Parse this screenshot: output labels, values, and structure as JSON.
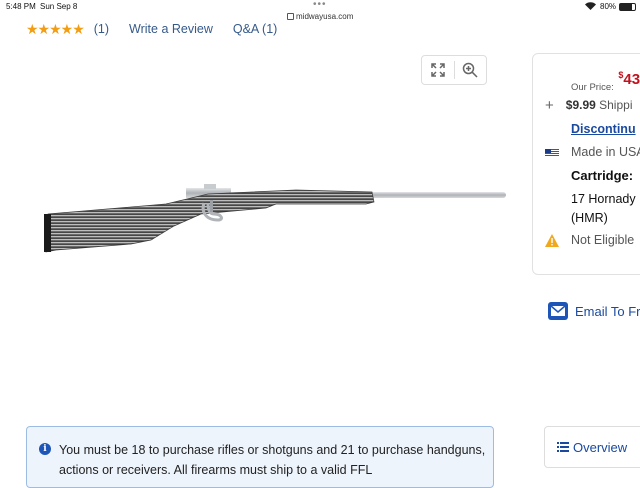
{
  "status_bar": {
    "time": "5:48 PM",
    "date": "Sun Sep 8",
    "url": "midwayusa.com",
    "battery": "80%",
    "battery_level": 0.8
  },
  "topnav": {
    "stars": "★★★★★",
    "rating_count": "(1)",
    "write_review": "Write a Review",
    "qa": "Q&A (1)"
  },
  "gallery": {
    "expand_icon": "expand-icon",
    "zoom_icon": "zoom-in-icon",
    "image_subject": "rifle-image"
  },
  "purchase_panel": {
    "our_price_label": "Our Price:",
    "price_symbol": "$",
    "price_value": "43",
    "shipping_price": "$9.99",
    "shipping_label": " Shippi",
    "discontinued": "Discontinu",
    "made_in": "Made in USA",
    "cartridge_label": "Cartridge:",
    "cartridge_value": "17 Hornady (HMR)",
    "not_eligible": "Not Eligible"
  },
  "email_link": "Email To Fr",
  "notice": {
    "text": "You must be 18 to purchase rifles or shotguns and 21 to purchase handguns, actions or receivers. All firearms must ship to a valid FFL"
  },
  "overview_tab": "Overview",
  "colors": {
    "price_red": "#c1121f",
    "link_blue": "#1a4aa0",
    "star_orange": "#f29d12",
    "notice_bg": "#eef4fc"
  }
}
